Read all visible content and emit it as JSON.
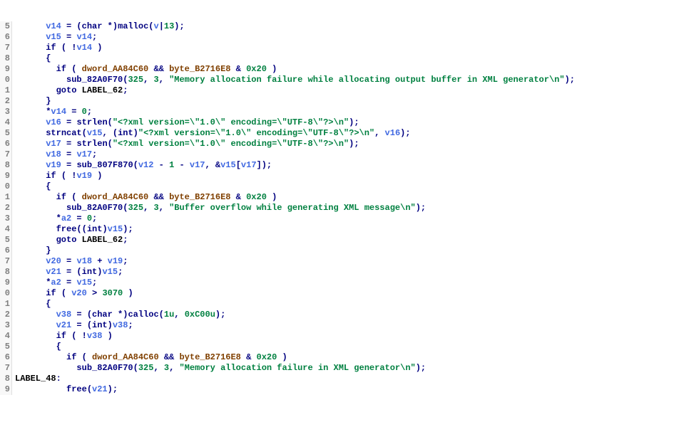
{
  "lines": [
    {
      "n": "5",
      "ind": 3,
      "tokens": [
        {
          "t": "var",
          "v": "v14"
        },
        {
          "t": "op",
          "v": " = ("
        },
        {
          "t": "type",
          "v": "char"
        },
        {
          "t": "op",
          "v": " *)"
        },
        {
          "t": "func",
          "v": "malloc"
        },
        {
          "t": "op",
          "v": "("
        },
        {
          "t": "var",
          "v": "v"
        },
        {
          "t": "cursor",
          "v": "|"
        },
        {
          "t": "num",
          "v": "13"
        },
        {
          "t": "op",
          "v": ");"
        }
      ]
    },
    {
      "n": "6",
      "ind": 3,
      "tokens": [
        {
          "t": "var",
          "v": "v15"
        },
        {
          "t": "op",
          "v": " = "
        },
        {
          "t": "var",
          "v": "v14"
        },
        {
          "t": "op",
          "v": ";"
        }
      ]
    },
    {
      "n": "7",
      "ind": 3,
      "tokens": [
        {
          "t": "kw",
          "v": "if"
        },
        {
          "t": "op",
          "v": " ( !"
        },
        {
          "t": "var",
          "v": "v14"
        },
        {
          "t": "op",
          "v": " )"
        }
      ]
    },
    {
      "n": "8",
      "ind": 3,
      "tokens": [
        {
          "t": "op",
          "v": "{"
        }
      ]
    },
    {
      "n": "9",
      "ind": 4,
      "tokens": [
        {
          "t": "kw",
          "v": "if"
        },
        {
          "t": "op",
          "v": " ( "
        },
        {
          "t": "glob",
          "v": "dword_AA84C60"
        },
        {
          "t": "op",
          "v": " && "
        },
        {
          "t": "glob",
          "v": "byte_B2716E8"
        },
        {
          "t": "op",
          "v": " & "
        },
        {
          "t": "num",
          "v": "0x20"
        },
        {
          "t": "op",
          "v": " )"
        }
      ]
    },
    {
      "n": "0",
      "ind": 5,
      "tokens": [
        {
          "t": "func",
          "v": "sub_82A0F70"
        },
        {
          "t": "op",
          "v": "("
        },
        {
          "t": "num",
          "v": "325"
        },
        {
          "t": "op",
          "v": ", "
        },
        {
          "t": "num",
          "v": "3"
        },
        {
          "t": "op",
          "v": ", "
        },
        {
          "t": "str",
          "v": "\"Memory allocation failure while allocating output buffer in XML generator\\n\""
        },
        {
          "t": "op",
          "v": ");"
        }
      ]
    },
    {
      "n": "1",
      "ind": 4,
      "tokens": [
        {
          "t": "kw",
          "v": "goto"
        },
        {
          "t": "op",
          "v": " "
        },
        {
          "t": "label",
          "v": "LABEL_62"
        },
        {
          "t": "op",
          "v": ";"
        }
      ]
    },
    {
      "n": "2",
      "ind": 3,
      "tokens": [
        {
          "t": "op",
          "v": "}"
        }
      ]
    },
    {
      "n": "3",
      "ind": 3,
      "tokens": [
        {
          "t": "op",
          "v": "*"
        },
        {
          "t": "var",
          "v": "v14"
        },
        {
          "t": "op",
          "v": " = "
        },
        {
          "t": "num",
          "v": "0"
        },
        {
          "t": "op",
          "v": ";"
        }
      ]
    },
    {
      "n": "4",
      "ind": 3,
      "tokens": [
        {
          "t": "var",
          "v": "v16"
        },
        {
          "t": "op",
          "v": " = "
        },
        {
          "t": "func",
          "v": "strlen"
        },
        {
          "t": "op",
          "v": "("
        },
        {
          "t": "str",
          "v": "\"<?xml version=\\\"1.0\\\" encoding=\\\"UTF-8\\\"?>\\n\""
        },
        {
          "t": "op",
          "v": ");"
        }
      ]
    },
    {
      "n": "5",
      "ind": 3,
      "tokens": [
        {
          "t": "func",
          "v": "strncat"
        },
        {
          "t": "op",
          "v": "("
        },
        {
          "t": "var",
          "v": "v15"
        },
        {
          "t": "op",
          "v": ", ("
        },
        {
          "t": "type",
          "v": "int"
        },
        {
          "t": "op",
          "v": ")"
        },
        {
          "t": "str",
          "v": "\"<?xml version=\\\"1.0\\\" encoding=\\\"UTF-8\\\"?>\\n\""
        },
        {
          "t": "op",
          "v": ", "
        },
        {
          "t": "var",
          "v": "v16"
        },
        {
          "t": "op",
          "v": ");"
        }
      ]
    },
    {
      "n": "6",
      "ind": 3,
      "tokens": [
        {
          "t": "var",
          "v": "v17"
        },
        {
          "t": "op",
          "v": " = "
        },
        {
          "t": "func",
          "v": "strlen"
        },
        {
          "t": "op",
          "v": "("
        },
        {
          "t": "str",
          "v": "\"<?xml version=\\\"1.0\\\" encoding=\\\"UTF-8\\\"?>\\n\""
        },
        {
          "t": "op",
          "v": ");"
        }
      ]
    },
    {
      "n": "7",
      "ind": 3,
      "tokens": [
        {
          "t": "var",
          "v": "v18"
        },
        {
          "t": "op",
          "v": " = "
        },
        {
          "t": "var",
          "v": "v17"
        },
        {
          "t": "op",
          "v": ";"
        }
      ]
    },
    {
      "n": "8",
      "ind": 3,
      "tokens": [
        {
          "t": "var",
          "v": "v19"
        },
        {
          "t": "op",
          "v": " = "
        },
        {
          "t": "func",
          "v": "sub_807F870"
        },
        {
          "t": "op",
          "v": "("
        },
        {
          "t": "var",
          "v": "v12"
        },
        {
          "t": "op",
          "v": " - "
        },
        {
          "t": "num",
          "v": "1"
        },
        {
          "t": "op",
          "v": " - "
        },
        {
          "t": "var",
          "v": "v17"
        },
        {
          "t": "op",
          "v": ", &"
        },
        {
          "t": "var",
          "v": "v15"
        },
        {
          "t": "op",
          "v": "["
        },
        {
          "t": "var",
          "v": "v17"
        },
        {
          "t": "op",
          "v": "]);"
        }
      ]
    },
    {
      "n": "9",
      "ind": 3,
      "tokens": [
        {
          "t": "kw",
          "v": "if"
        },
        {
          "t": "op",
          "v": " ( !"
        },
        {
          "t": "var",
          "v": "v19"
        },
        {
          "t": "op",
          "v": " )"
        }
      ]
    },
    {
      "n": "0",
      "ind": 3,
      "tokens": [
        {
          "t": "op",
          "v": "{"
        }
      ]
    },
    {
      "n": "1",
      "ind": 4,
      "tokens": [
        {
          "t": "kw",
          "v": "if"
        },
        {
          "t": "op",
          "v": " ( "
        },
        {
          "t": "glob",
          "v": "dword_AA84C60"
        },
        {
          "t": "op",
          "v": " && "
        },
        {
          "t": "glob",
          "v": "byte_B2716E8"
        },
        {
          "t": "op",
          "v": " & "
        },
        {
          "t": "num",
          "v": "0x20"
        },
        {
          "t": "op",
          "v": " )"
        }
      ]
    },
    {
      "n": "2",
      "ind": 5,
      "tokens": [
        {
          "t": "func",
          "v": "sub_82A0F70"
        },
        {
          "t": "op",
          "v": "("
        },
        {
          "t": "num",
          "v": "325"
        },
        {
          "t": "op",
          "v": ", "
        },
        {
          "t": "num",
          "v": "3"
        },
        {
          "t": "op",
          "v": ", "
        },
        {
          "t": "str",
          "v": "\"Buffer overflow while generating XML message\\n\""
        },
        {
          "t": "op",
          "v": ");"
        }
      ]
    },
    {
      "n": "3",
      "ind": 4,
      "tokens": [
        {
          "t": "op",
          "v": "*"
        },
        {
          "t": "var",
          "v": "a2"
        },
        {
          "t": "op",
          "v": " = "
        },
        {
          "t": "num",
          "v": "0"
        },
        {
          "t": "op",
          "v": ";"
        }
      ]
    },
    {
      "n": "4",
      "ind": 4,
      "tokens": [
        {
          "t": "func",
          "v": "free"
        },
        {
          "t": "op",
          "v": "(("
        },
        {
          "t": "type",
          "v": "int"
        },
        {
          "t": "op",
          "v": ")"
        },
        {
          "t": "var",
          "v": "v15"
        },
        {
          "t": "op",
          "v": ");"
        }
      ]
    },
    {
      "n": "5",
      "ind": 4,
      "tokens": [
        {
          "t": "kw",
          "v": "goto"
        },
        {
          "t": "op",
          "v": " "
        },
        {
          "t": "label",
          "v": "LABEL_62"
        },
        {
          "t": "op",
          "v": ";"
        }
      ]
    },
    {
      "n": "6",
      "ind": 3,
      "tokens": [
        {
          "t": "op",
          "v": "}"
        }
      ]
    },
    {
      "n": "7",
      "ind": 3,
      "tokens": [
        {
          "t": "var",
          "v": "v20"
        },
        {
          "t": "op",
          "v": " = "
        },
        {
          "t": "var",
          "v": "v18"
        },
        {
          "t": "op",
          "v": " + "
        },
        {
          "t": "var",
          "v": "v19"
        },
        {
          "t": "op",
          "v": ";"
        }
      ]
    },
    {
      "n": "8",
      "ind": 3,
      "tokens": [
        {
          "t": "var",
          "v": "v21"
        },
        {
          "t": "op",
          "v": " = ("
        },
        {
          "t": "type",
          "v": "int"
        },
        {
          "t": "op",
          "v": ")"
        },
        {
          "t": "var",
          "v": "v15"
        },
        {
          "t": "op",
          "v": ";"
        }
      ]
    },
    {
      "n": "9",
      "ind": 3,
      "tokens": [
        {
          "t": "op",
          "v": "*"
        },
        {
          "t": "var",
          "v": "a2"
        },
        {
          "t": "op",
          "v": " = "
        },
        {
          "t": "var",
          "v": "v15"
        },
        {
          "t": "op",
          "v": ";"
        }
      ]
    },
    {
      "n": "0",
      "ind": 3,
      "tokens": [
        {
          "t": "kw",
          "v": "if"
        },
        {
          "t": "op",
          "v": " ( "
        },
        {
          "t": "var",
          "v": "v20"
        },
        {
          "t": "op",
          "v": " > "
        },
        {
          "t": "num",
          "v": "3070"
        },
        {
          "t": "op",
          "v": " )"
        }
      ]
    },
    {
      "n": "1",
      "ind": 3,
      "tokens": [
        {
          "t": "op",
          "v": "{"
        }
      ]
    },
    {
      "n": "2",
      "ind": 4,
      "tokens": [
        {
          "t": "var",
          "v": "v38"
        },
        {
          "t": "op",
          "v": " = ("
        },
        {
          "t": "type",
          "v": "char"
        },
        {
          "t": "op",
          "v": " *)"
        },
        {
          "t": "func",
          "v": "calloc"
        },
        {
          "t": "op",
          "v": "("
        },
        {
          "t": "num",
          "v": "1u"
        },
        {
          "t": "op",
          "v": ", "
        },
        {
          "t": "num",
          "v": "0xC00u"
        },
        {
          "t": "op",
          "v": ");"
        }
      ]
    },
    {
      "n": "3",
      "ind": 4,
      "tokens": [
        {
          "t": "var",
          "v": "v21"
        },
        {
          "t": "op",
          "v": " = ("
        },
        {
          "t": "type",
          "v": "int"
        },
        {
          "t": "op",
          "v": ")"
        },
        {
          "t": "var",
          "v": "v38"
        },
        {
          "t": "op",
          "v": ";"
        }
      ]
    },
    {
      "n": "4",
      "ind": 4,
      "tokens": [
        {
          "t": "kw",
          "v": "if"
        },
        {
          "t": "op",
          "v": " ( !"
        },
        {
          "t": "var",
          "v": "v38"
        },
        {
          "t": "op",
          "v": " )"
        }
      ]
    },
    {
      "n": "5",
      "ind": 4,
      "tokens": [
        {
          "t": "op",
          "v": "{"
        }
      ]
    },
    {
      "n": "6",
      "ind": 5,
      "tokens": [
        {
          "t": "kw",
          "v": "if"
        },
        {
          "t": "op",
          "v": " ( "
        },
        {
          "t": "glob",
          "v": "dword_AA84C60"
        },
        {
          "t": "op",
          "v": " && "
        },
        {
          "t": "glob",
          "v": "byte_B2716E8"
        },
        {
          "t": "op",
          "v": " & "
        },
        {
          "t": "num",
          "v": "0x20"
        },
        {
          "t": "op",
          "v": " )"
        }
      ]
    },
    {
      "n": "7",
      "ind": 6,
      "tokens": [
        {
          "t": "func",
          "v": "sub_82A0F70"
        },
        {
          "t": "op",
          "v": "("
        },
        {
          "t": "num",
          "v": "325"
        },
        {
          "t": "op",
          "v": ", "
        },
        {
          "t": "num",
          "v": "3"
        },
        {
          "t": "op",
          "v": ", "
        },
        {
          "t": "str",
          "v": "\"Memory allocation failure in XML generator\\n\""
        },
        {
          "t": "op",
          "v": ");"
        }
      ]
    },
    {
      "n": "8",
      "ind": 0,
      "tokens": [
        {
          "t": "label",
          "v": "LABEL_48"
        },
        {
          "t": "op",
          "v": ":"
        }
      ]
    },
    {
      "n": "9",
      "ind": 5,
      "tokens": [
        {
          "t": "func",
          "v": "free"
        },
        {
          "t": "op",
          "v": "("
        },
        {
          "t": "var",
          "v": "v21"
        },
        {
          "t": "op",
          "v": ");"
        }
      ]
    }
  ]
}
